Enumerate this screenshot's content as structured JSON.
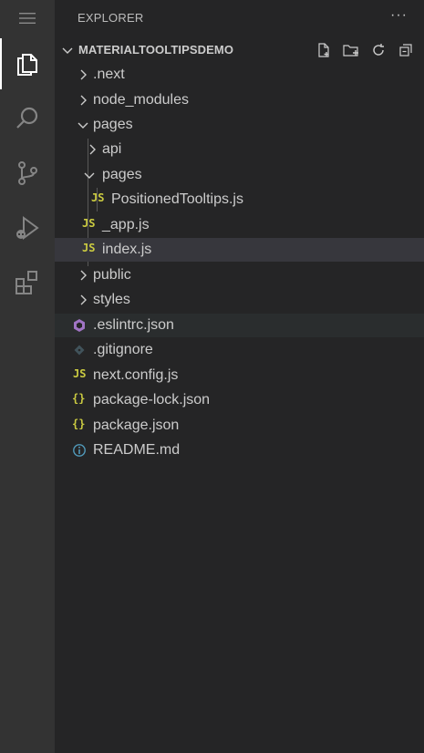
{
  "explorer": {
    "title": "EXPLORER",
    "more": "···"
  },
  "project": {
    "name": "MATERIALTOOLTIPSDEMO"
  },
  "tree": {
    "next": ".next",
    "node_modules": "node_modules",
    "pages": "pages",
    "api": "api",
    "pages_inner": "pages",
    "positioned": "PositionedTooltips.js",
    "app": "_app.js",
    "index": "index.js",
    "public": "public",
    "styles": "styles",
    "eslintrc": ".eslintrc.json",
    "gitignore": ".gitignore",
    "nextconfig": "next.config.js",
    "packagelock": "package-lock.json",
    "package": "package.json",
    "readme": "README.md"
  },
  "icons": {
    "js": "JS",
    "braces": "{}",
    "info": "ⓘ"
  },
  "colors": {
    "js": "#cbcb41",
    "eslint": "#a074c4",
    "info": "#519aba",
    "selected": "#37373d"
  }
}
